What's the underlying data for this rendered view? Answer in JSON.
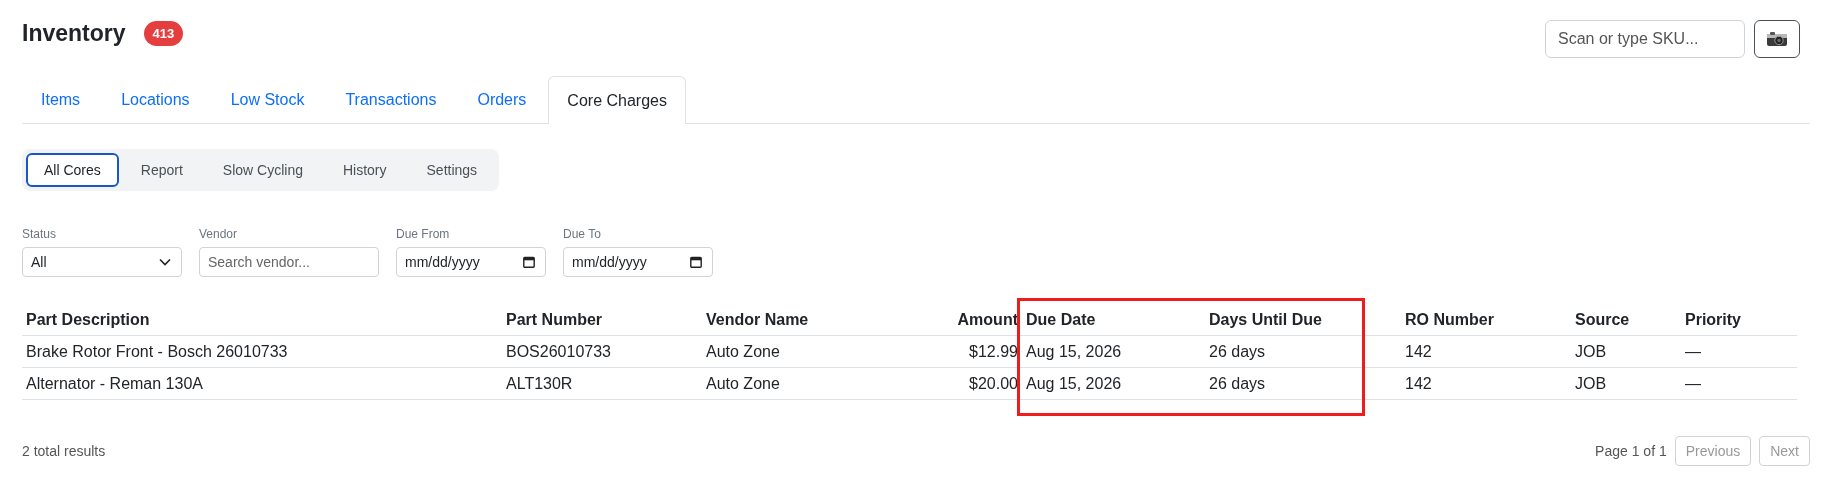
{
  "header": {
    "title": "Inventory",
    "badge": "413",
    "scan": {
      "placeholder": "Scan or type SKU..."
    }
  },
  "tabs": [
    {
      "label": "Items",
      "selected": false
    },
    {
      "label": "Locations",
      "selected": false
    },
    {
      "label": "Low Stock",
      "selected": false
    },
    {
      "label": "Transactions",
      "selected": false
    },
    {
      "label": "Orders",
      "selected": false
    },
    {
      "label": "Core Charges",
      "selected": true
    }
  ],
  "subtabs": [
    {
      "label": "All Cores",
      "selected": true
    },
    {
      "label": "Report",
      "selected": false
    },
    {
      "label": "Slow Cycling",
      "selected": false
    },
    {
      "label": "History",
      "selected": false
    },
    {
      "label": "Settings",
      "selected": false
    }
  ],
  "filters": [
    {
      "kind": "select",
      "label": "Status",
      "value": "All"
    },
    {
      "kind": "text",
      "label": "Vendor",
      "placeholder": "Search vendor..."
    },
    {
      "kind": "date",
      "label": "Due From",
      "value": "mm/dd/yyyy"
    },
    {
      "kind": "date",
      "label": "Due To",
      "value": "mm/dd/yyyy"
    }
  ],
  "table": {
    "columns": [
      "Part Description",
      "Part Number",
      "Vendor Name",
      "Amount",
      "Due Date",
      "Days Until Due",
      "RO Number",
      "Source",
      "Priority"
    ],
    "rows": [
      [
        "Brake Rotor Front - Bosch 26010733",
        "BOS26010733",
        "Auto Zone",
        "$12.99",
        "Aug 15, 2026",
        "26 days",
        "142",
        "JOB",
        "—"
      ],
      [
        "Alternator - Reman 130A",
        "ALT130R",
        "Auto Zone",
        "$20.00",
        "Aug 15, 2026",
        "26 days",
        "142",
        "JOB",
        "—"
      ]
    ]
  },
  "footer": {
    "total": "2 total results",
    "page": "Page 1 of 1",
    "buttons": [
      {
        "label": "Previous",
        "disabled": true
      },
      {
        "label": "Next",
        "disabled": true
      }
    ]
  }
}
